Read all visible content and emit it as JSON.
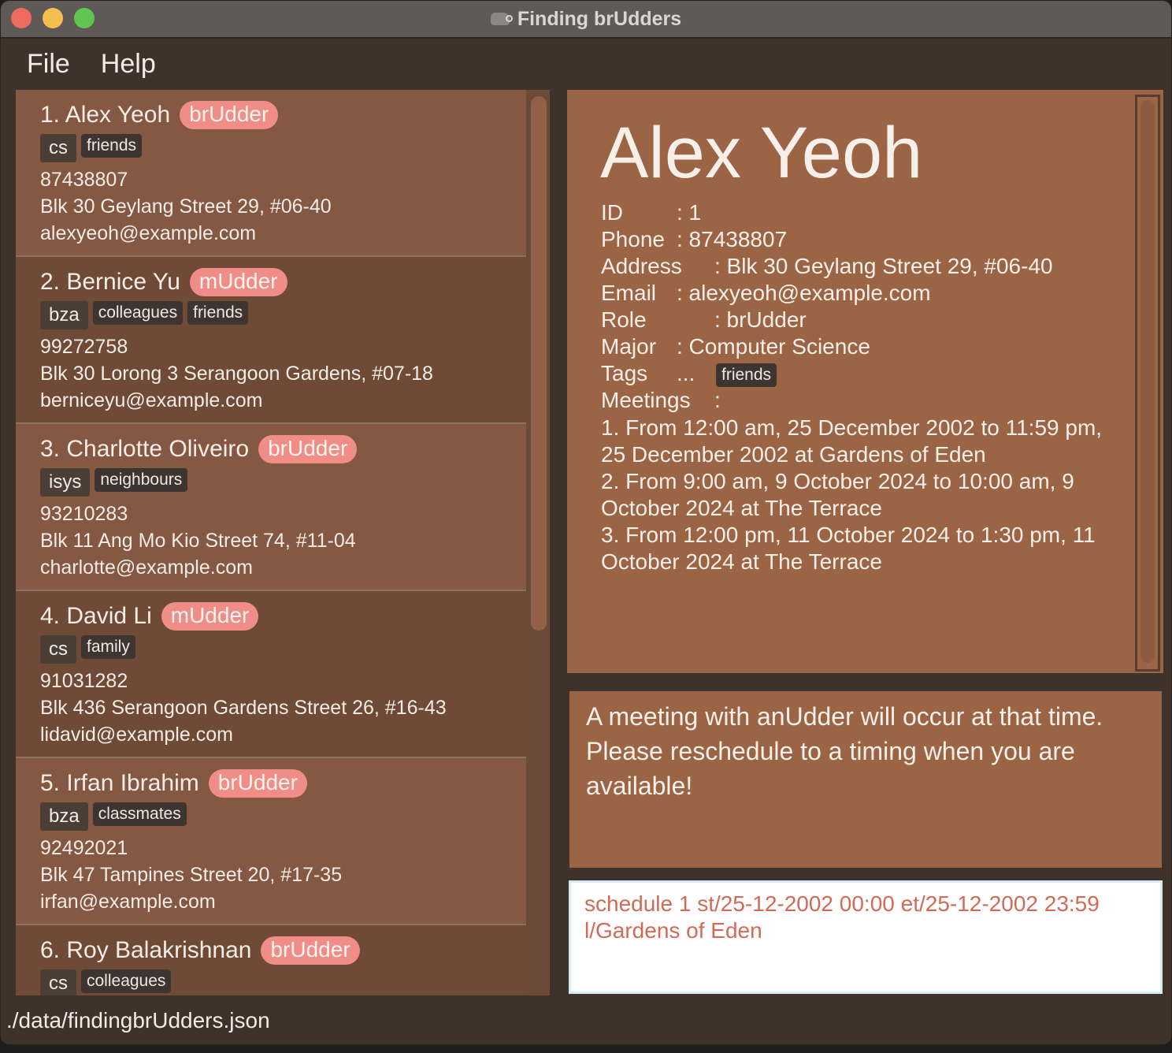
{
  "window": {
    "title": "Finding brUdders",
    "app_icon": "cow-magnifier-icon"
  },
  "menu": {
    "items": [
      "File",
      "Help"
    ]
  },
  "persons": [
    {
      "name": "1. Alex Yeoh",
      "role": "brUdder",
      "major": "cs",
      "tags": [
        "friends"
      ],
      "phone": "87438807",
      "address": "Blk 30 Geylang Street 29, #06-40",
      "email": "alexyeoh@example.com"
    },
    {
      "name": "2. Bernice Yu",
      "role": "mUdder",
      "major": "bza",
      "tags": [
        "colleagues",
        "friends"
      ],
      "phone": "99272758",
      "address": "Blk 30 Lorong 3 Serangoon Gardens, #07-18",
      "email": "berniceyu@example.com"
    },
    {
      "name": "3. Charlotte Oliveiro",
      "role": "brUdder",
      "major": "isys",
      "tags": [
        "neighbours"
      ],
      "phone": "93210283",
      "address": "Blk 11 Ang Mo Kio Street 74, #11-04",
      "email": "charlotte@example.com"
    },
    {
      "name": "4. David Li",
      "role": "mUdder",
      "major": "cs",
      "tags": [
        "family"
      ],
      "phone": "91031282",
      "address": "Blk 436 Serangoon Gardens Street 26, #16-43",
      "email": "lidavid@example.com"
    },
    {
      "name": "5. Irfan Ibrahim",
      "role": "brUdder",
      "major": "bza",
      "tags": [
        "classmates"
      ],
      "phone": "92492021",
      "address": "Blk 47 Tampines Street 20, #17-35",
      "email": "irfan@example.com"
    },
    {
      "name": "6. Roy Balakrishnan",
      "role": "brUdder",
      "major": "cs",
      "tags": [
        "colleagues"
      ],
      "phone": "",
      "address": "",
      "email": ""
    }
  ],
  "detail": {
    "name": "Alex Yeoh",
    "rows": [
      {
        "label": "ID",
        "sep": ": 1"
      },
      {
        "label": "Phone",
        "sep": ": 87438807"
      },
      {
        "label": "Address",
        "sep": ": Blk 30 Geylang Street 29, #06-40"
      },
      {
        "label": "Email",
        "sep": ": alexyeoh@example.com"
      },
      {
        "label": "Role",
        "sep": ": brUdder"
      },
      {
        "label": "Major",
        "sep": ": Computer Science"
      }
    ],
    "tags_label": "Tags",
    "tags_sep": "...",
    "tags": [
      "friends"
    ],
    "meetings_label": "Meetings",
    "meetings_sep": ":",
    "meetings": [
      "1. From 12:00 am, 25 December 2002 to 11:59 pm, 25 December 2002 at Gardens of Eden",
      "2. From 9:00 am, 9 October 2024 to 10:00 am, 9 October 2024 at The Terrace",
      "3. From 12:00 pm, 11 October 2024 to 1:30 pm, 11 October 2024 at The Terrace"
    ]
  },
  "result": {
    "message": "A meeting with anUdder will occur at that time. Please reschedule to a timing when you are available!"
  },
  "command": {
    "value": "schedule 1 st/25-12-2002 00:00 et/25-12-2002 23:59 l/Gardens of Eden"
  },
  "status": {
    "file_path": "./data/findingbrUdders.json"
  },
  "colors": {
    "background": "#3f322b",
    "card_light": "#845843",
    "card_dark": "#6e4a37",
    "role_badge": "#f08d86",
    "panel": "#9b6445",
    "command_text": "#d26a56"
  }
}
